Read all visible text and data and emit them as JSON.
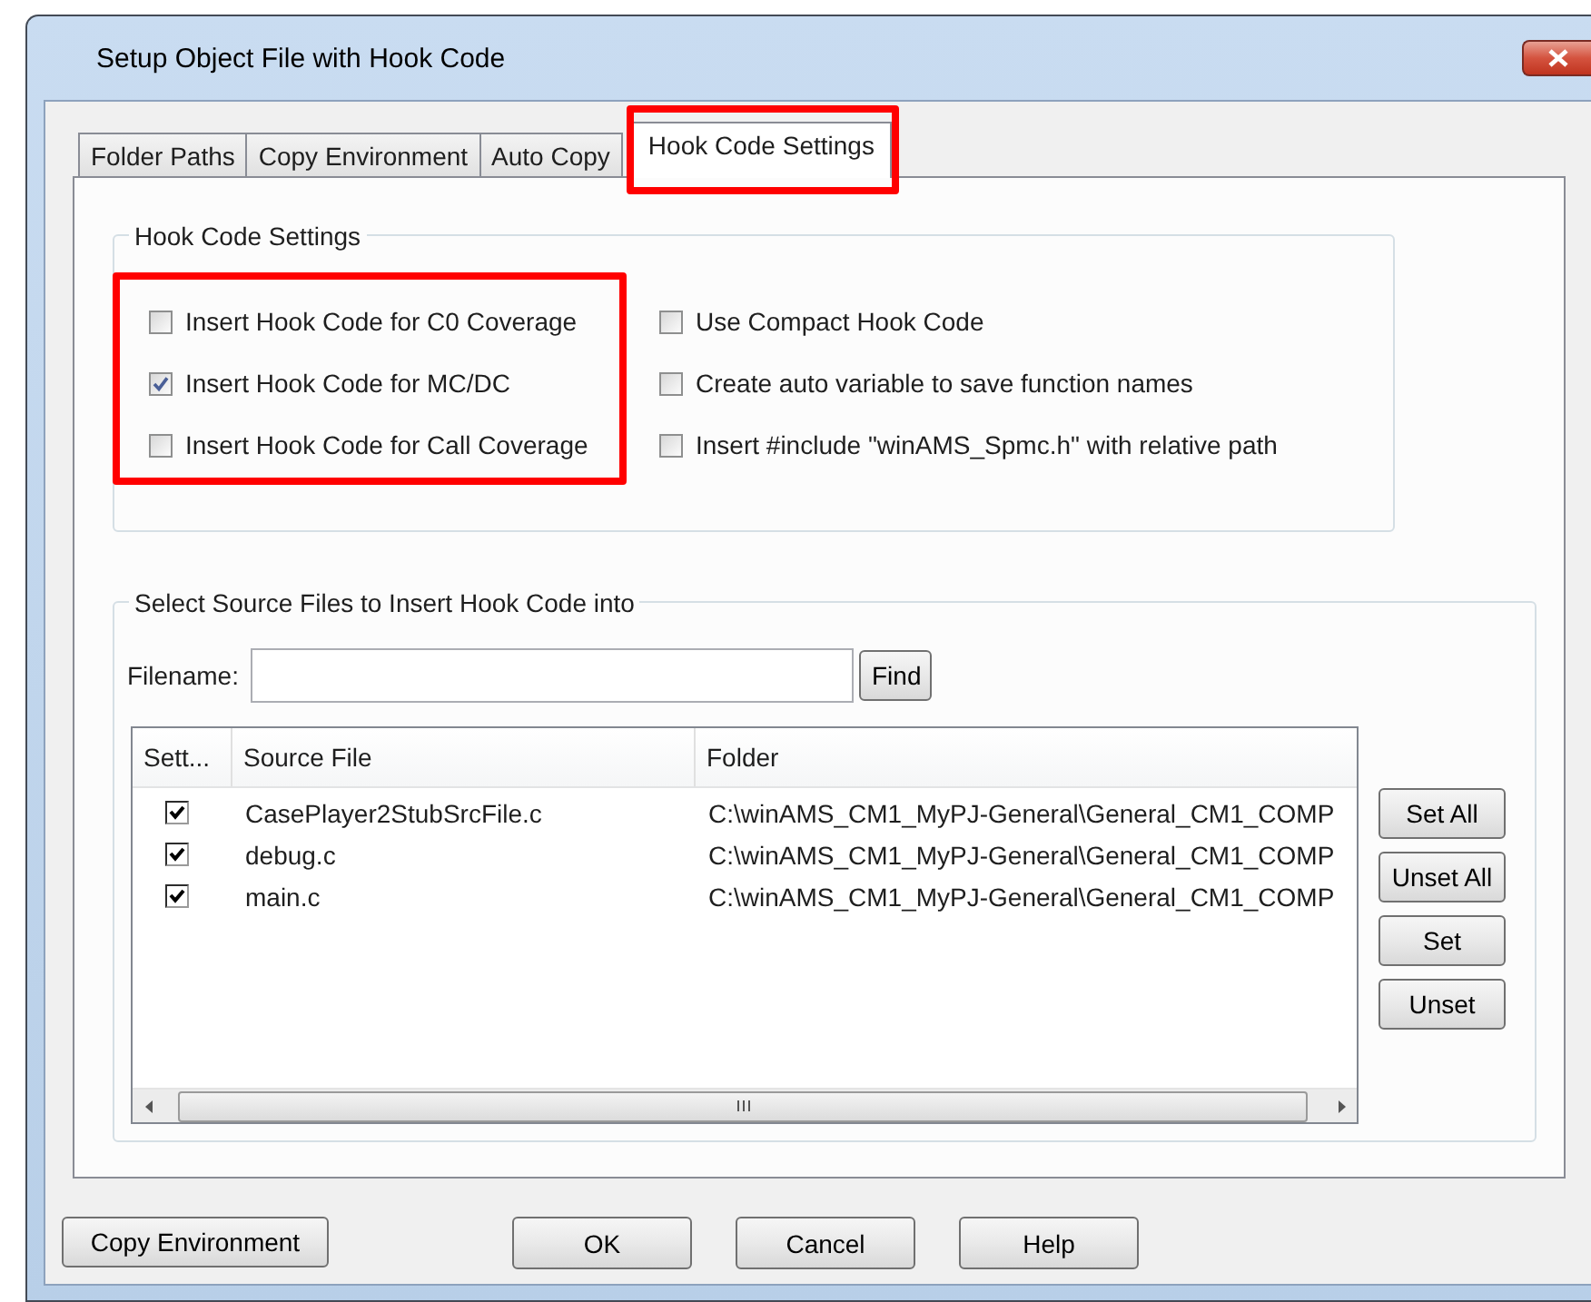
{
  "window": {
    "title": "Setup Object File with Hook Code"
  },
  "tabs": [
    {
      "label": "Folder Paths",
      "selected": false,
      "highlighted": false
    },
    {
      "label": "Copy Environment",
      "selected": false,
      "highlighted": false
    },
    {
      "label": "Auto Copy",
      "selected": false,
      "highlighted": false
    },
    {
      "label": "Hook Code Settings",
      "selected": true,
      "highlighted": true
    }
  ],
  "hook_code_settings": {
    "title": "Hook Code Settings",
    "columns": [
      {
        "highlighted": true,
        "options": [
          {
            "label": "Insert Hook Code for C0 Coverage",
            "checked": false
          },
          {
            "label": "Insert Hook Code for MC/DC",
            "checked": true
          },
          {
            "label": "Insert Hook Code for Call Coverage",
            "checked": false
          }
        ]
      },
      {
        "highlighted": false,
        "options": [
          {
            "label": "Use Compact Hook Code",
            "checked": false
          },
          {
            "label": "Create auto variable to save function names",
            "checked": false
          },
          {
            "label": "Insert #include \"winAMS_Spmc.h\" with relative path",
            "checked": false
          }
        ]
      }
    ]
  },
  "source_files": {
    "title": "Select Source Files to Insert Hook Code into",
    "filename": {
      "label": "Filename:"
    },
    "find_button": "Find",
    "table": {
      "columns": [
        "Sett...",
        "Source File",
        "Folder"
      ],
      "rows": [
        {
          "checked": true,
          "source_file": "CasePlayer2StubSrcFile.c",
          "folder": "C:\\winAMS_CM1_MyPJ-General\\General_CM1_COMP"
        },
        {
          "checked": true,
          "source_file": "debug.c",
          "folder": "C:\\winAMS_CM1_MyPJ-General\\General_CM1_COMP"
        },
        {
          "checked": true,
          "source_file": "main.c",
          "folder": "C:\\winAMS_CM1_MyPJ-General\\General_CM1_COMP"
        }
      ]
    },
    "side_buttons": [
      "Set All",
      "Unset All",
      "Set",
      "Unset"
    ]
  },
  "left_button": "Copy Environment",
  "buttons": [
    "OK",
    "Cancel",
    "Help"
  ]
}
